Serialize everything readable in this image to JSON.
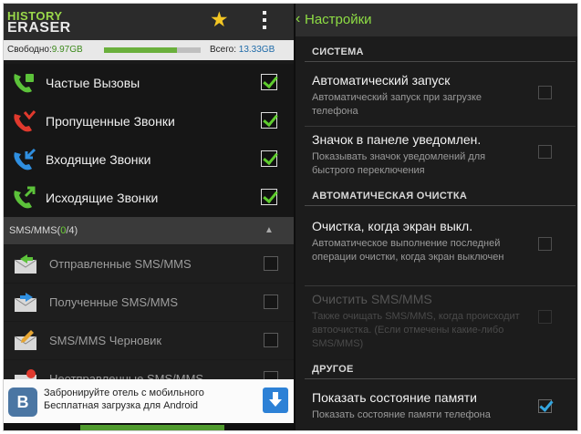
{
  "left": {
    "logo": {
      "line1": "HISTORY",
      "line2": "ERASER"
    },
    "star_icon": "star-icon",
    "menu_icon": "overflow-menu-icon",
    "storage": {
      "free_label": "Свободно:",
      "free_value": "9.97GB",
      "used_fraction": 0.75,
      "total_label": "Всего:",
      "total_value": "13.33GB"
    },
    "call_items": [
      {
        "label": "Частые Вызовы",
        "icon": "frequent-calls-icon",
        "checked": true,
        "color": "#5cc23a"
      },
      {
        "label": "Пропущенные Звонки",
        "icon": "missed-calls-icon",
        "checked": true,
        "color": "#e0392d"
      },
      {
        "label": "Входящие Звонки",
        "icon": "incoming-calls-icon",
        "checked": true,
        "color": "#2f8fe0"
      },
      {
        "label": "Исходящие Звонки",
        "icon": "outgoing-calls-icon",
        "checked": true,
        "color": "#5cc23a"
      }
    ],
    "sms_section": {
      "prefix": "SMS/MMS(",
      "count_selected": "0",
      "count_rest": "/4)"
    },
    "sms_items": [
      {
        "label": "Отправленные SMS/MMS",
        "icon": "sent-sms-icon",
        "checked": false
      },
      {
        "label": "Полученные SMS/MMS",
        "icon": "received-sms-icon",
        "checked": false
      },
      {
        "label": "SMS/MMS Черновик",
        "icon": "draft-sms-icon",
        "checked": false
      },
      {
        "label": "Неотправленные SMS/MMS",
        "icon": "unsent-sms-icon",
        "checked": false
      }
    ],
    "ad": {
      "logo_letter": "B",
      "line1": "Забронируйте отель с мобильного",
      "line2": "Бесплатная загрузка для Android"
    }
  },
  "right": {
    "header": {
      "back": "‹",
      "title": "Настройки"
    },
    "sections": [
      {
        "title": "СИСТЕМА"
      },
      {
        "title": "АВТОМАТИЧЕСКАЯ ОЧИСТКА"
      },
      {
        "title": "ДРУГОЕ"
      }
    ],
    "prefs": [
      {
        "title": "Автоматический запуск",
        "summary": "Автоматический запуск при загрузке телефона",
        "checked": false,
        "enabled": true
      },
      {
        "title": "Значок в панеле уведомлен.",
        "summary": "Показывать значок уведомлений для быстрого переключения",
        "checked": false,
        "enabled": true
      },
      {
        "title": "Очистка, когда экран выкл.",
        "summary": "Автоматическое выполнение последней операции очистки, когда экран выключен",
        "checked": false,
        "enabled": true
      },
      {
        "title": "Очистить SMS/MMS",
        "summary": "Также очищать SMS/MMS, когда происходит автоочистка. (Если отмечены какие-либо SMS/MMS)",
        "checked": false,
        "enabled": false
      },
      {
        "title": "Показать состояние памяти",
        "summary": "Показать состояние памяти телефона",
        "checked": true,
        "enabled": true
      }
    ]
  },
  "colors": {
    "accent_green": "#8edd44",
    "check_blue": "#34a6e0",
    "background": "#1c1c1c"
  }
}
